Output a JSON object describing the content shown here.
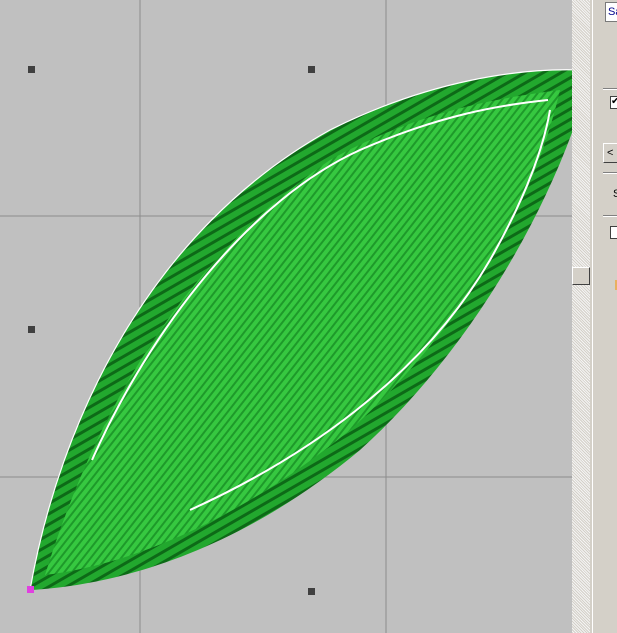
{
  "panel": {
    "name_value": "Sa",
    "checkbox1_checked": true,
    "back_label": "<",
    "section_label": "S",
    "checkbox2_checked": false
  },
  "colors": {
    "canvas": "#c0c0c0",
    "stitch": "#2fbf3a",
    "stitch_dark": "#157a1f",
    "outline": "#ffffff"
  },
  "icons": {
    "checkmark": "✔"
  }
}
